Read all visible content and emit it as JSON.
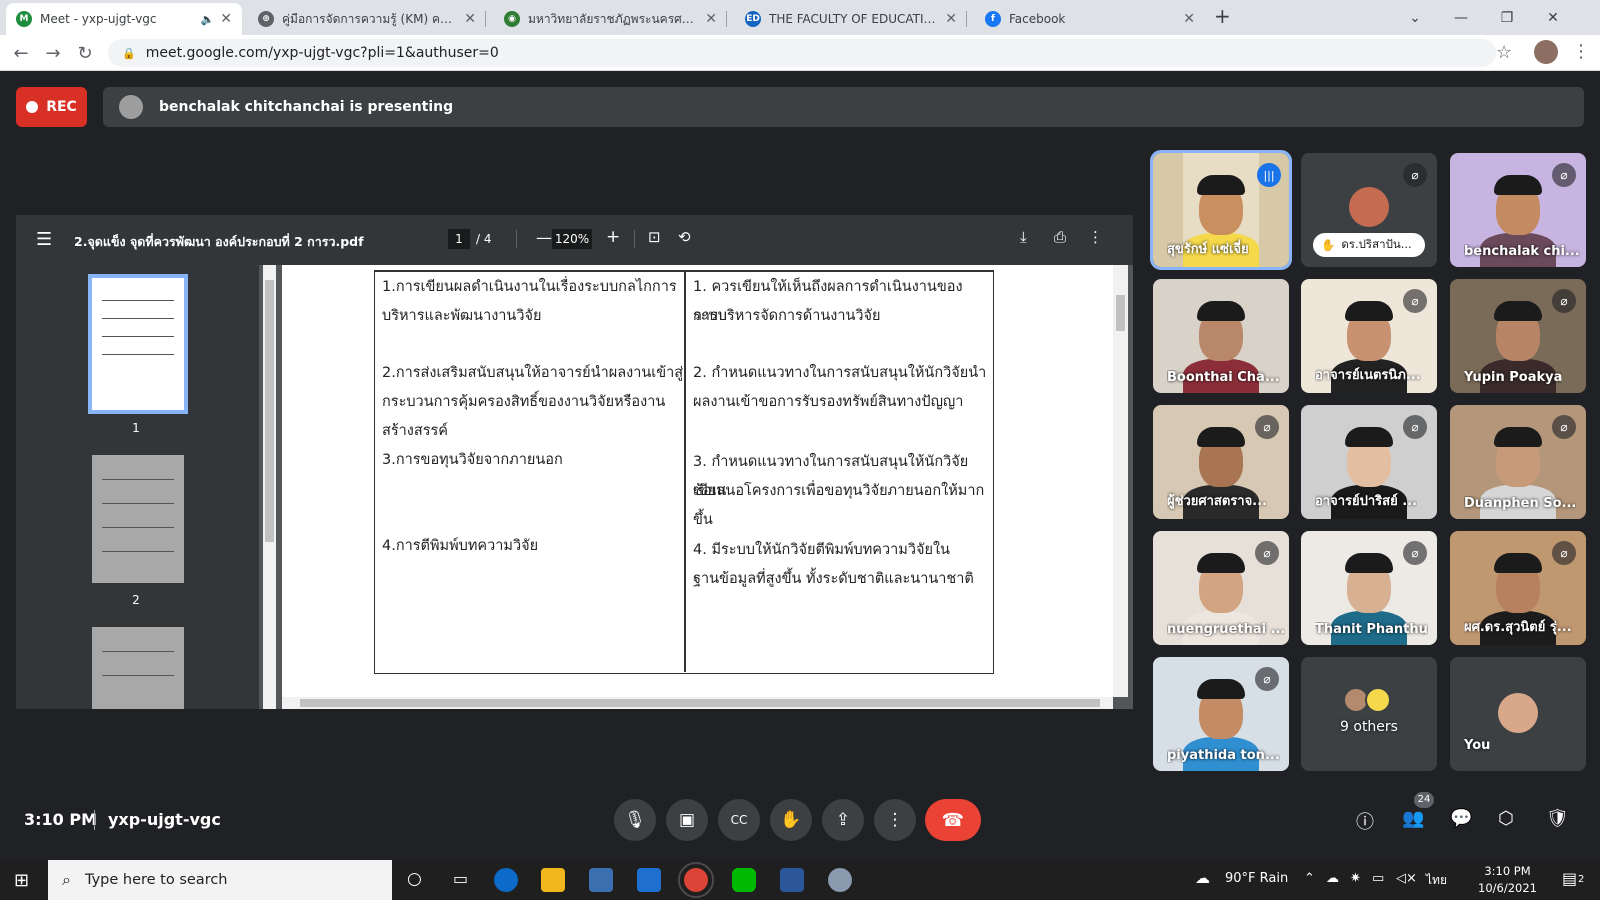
{
  "tabs": [
    {
      "title": "Meet - yxp-ujgt-vgc",
      "color": "#1e8e3e",
      "glyph": "M",
      "has_audio": true,
      "audio_icon": "speaker-icon"
    },
    {
      "title": "คู่มือการจัดการความรู้ (KM) คณะครุศาสตร์",
      "color": "#5f6368",
      "glyph": "⊕",
      "has_audio": false
    },
    {
      "title": "มหาวิทยาลัยราชภัฏพระนครศรีอยุธยา",
      "color": "#2e7d32",
      "glyph": "◉",
      "has_audio": false
    },
    {
      "title": "THE FACULTY OF EDUCATION",
      "color": "#1565c0",
      "glyph": "ED",
      "has_audio": false
    },
    {
      "title": "Facebook",
      "color": "#1877f2",
      "glyph": "f",
      "has_audio": false
    }
  ],
  "close_glyph": "✕",
  "newtab_glyph": "+",
  "window_controls": {
    "dropdown": "⌄",
    "minimize": "—",
    "maximize": "❐",
    "close": "✕"
  },
  "address": {
    "url": "meet.google.com/yxp-ujgt-vgc?pli=1&authuser=0",
    "lock_glyph": "🔒"
  },
  "nav_glyphs": {
    "back": "←",
    "forward": "→",
    "reload": "↻",
    "star": "☆",
    "kebab": "⋮"
  },
  "rec_label": "REC",
  "presenting_text": "benchalak chitchanchai is presenting",
  "pdf": {
    "filename": "2.จุดแข็ง จุดที่ควรพัฒนา องค์ประกอบที่ 2 การว.pdf",
    "current_page": "1",
    "total_pages": "/  4",
    "zoom": "120%",
    "zoom_out": "—",
    "zoom_in": "+",
    "menu_glyph": "☰",
    "fit_glyph": "⊡",
    "rotate_glyph": "⟲",
    "download_glyph": "⤓",
    "print_glyph": "⎙",
    "more_glyph": "⋮",
    "thumb_numbers": [
      "1",
      "2"
    ],
    "left_column": [
      "1.การเขียนผลดำเนินงานในเรื่องระบบกลไกการ",
      "บริหารและพัฒนางานวิจัย",
      "2.การส่งเสริมสนับสนุนให้อาจารย์นำผลงานเข้าสู่",
      "กระบวนการคุ้มครองสิทธิ์ของงานวิจัยหรืองาน",
      "สร้างสรรค์",
      "3.การขอทุนวิจัยจากภายนอก",
      "4.การตีพิมพ์บทความวิจัย"
    ],
    "right_column": [
      "1.  ควรเขียนให้เห็นถึงผลการดำเนินงานของระบบ",
      "การบริหารจัดการด้านงานวิจัย",
      "2.  กำหนดแนวทางในการสนับสนุนให้นักวิจัยนำ",
      "ผลงานเข้าขอการรับรองทรัพย์สินทางปัญญา",
      "3.  กำหนดแนวทางในการสนับสนุนให้นักวิจัยเขียน",
      "ข้อเสนอโครงการเพื่อขอทุนวิจัยภายนอกให้มากขึ้น",
      "4.  มีระบบให้นักวิจัยตีพิมพ์บทความวิจัยใน",
      "ฐานข้อมูลที่สูงขึ้น ทั้งระดับชาติและนานาชาติ"
    ]
  },
  "participants": [
    {
      "name": "สุขรักษ์ แซ่เจี่ย",
      "bg": "#d7c9a8",
      "skin": "#c98f5e",
      "shirt": "#f5d94a",
      "muted": false,
      "speaking": true
    },
    {
      "name": "ดร.ปริสาปัน...",
      "bg": "#3c4043",
      "avatar": true,
      "avatar_color": "#c56b52",
      "muted": true,
      "pill": true,
      "hand_icon": "✋"
    },
    {
      "name": "benchalak chi...",
      "bg": "#c8b4e0",
      "skin": "#c48a62",
      "shirt": "#6a4a5a",
      "muted": true
    },
    {
      "name": "Boonthai Cha...",
      "bg": "#d8d2c8",
      "skin": "#b9876a",
      "shirt": "#8b2e3a",
      "muted": false
    },
    {
      "name": "อาจารย์เนตรนิภ...",
      "bg": "#efe6da",
      "skin": "#c89270",
      "shirt": "#222222",
      "muted": true
    },
    {
      "name": "Yupin Poakya",
      "bg": "#7a6a58",
      "skin": "#b88466",
      "shirt": "#3a2a2a",
      "muted": true
    },
    {
      "name": "ผู้ช่วยศาสตราจ...",
      "bg": "#d6c8b2",
      "skin": "#a87452",
      "shirt": "#2a2a2a",
      "muted": true
    },
    {
      "name": "อาจารย์ปาริสย์ ...",
      "bg": "#cfcfcf",
      "skin": "#e4bea0",
      "shirt": "#1a1a1a",
      "muted": true
    },
    {
      "name": "Duanphen So...",
      "bg": "#b4977a",
      "skin": "#c79a7a",
      "shirt": "#d6d6d6",
      "muted": true
    },
    {
      "name": "nuengruethai ...",
      "bg": "#e6e0d8",
      "skin": "#d2a482",
      "shirt": "#ece6de",
      "muted": true
    },
    {
      "name": "Thanit Phanthu",
      "bg": "#ede9e4",
      "skin": "#d8b092",
      "shirt": "#1e6b8a",
      "muted": true
    },
    {
      "name": "ผศ.ดร.สุวนิตย์ รุ่...",
      "bg": "#c09870",
      "skin": "#b7805e",
      "shirt": "#1c1c1c",
      "muted": true
    },
    {
      "name": "piyathida ton...",
      "bg": "#d7dfe6",
      "skin": "#c48c64",
      "shirt": "#2f8fd0",
      "muted": true
    },
    {
      "name": "9 others",
      "bg": "#3c4043",
      "others": true,
      "muted": false
    },
    {
      "name": "You",
      "bg": "#3c4043",
      "avatar": true,
      "avatar_color": "#d9a88a",
      "muted": false,
      "you": true
    }
  ],
  "mute_glyph": "⌀",
  "talk_glyph": "|||",
  "bottom": {
    "time": "3:10 PM",
    "meeting_code": "yxp-ujgt-vgc",
    "controls": [
      {
        "name": "mic-button",
        "glyph": "🎙",
        "icon": "mic-icon"
      },
      {
        "name": "camera-button",
        "glyph": "▣",
        "icon": "camera-icon"
      },
      {
        "name": "captions-button",
        "glyph": "CC",
        "icon": "captions-icon"
      },
      {
        "name": "raise-hand-button",
        "glyph": "✋",
        "icon": "hand-icon"
      },
      {
        "name": "present-button",
        "glyph": "⇪",
        "icon": "present-icon"
      },
      {
        "name": "more-options-button",
        "glyph": "⋮",
        "icon": "more-vert-icon"
      }
    ],
    "end_call_glyph": "☎",
    "right_icons": [
      {
        "name": "meeting-details-button",
        "glyph": "ⓘ",
        "icon": "info-icon"
      },
      {
        "name": "people-button",
        "glyph": "👥",
        "icon": "people-icon"
      },
      {
        "name": "chat-button",
        "glyph": "💬",
        "icon": "chat-icon"
      },
      {
        "name": "activities-button",
        "glyph": "⬡",
        "icon": "activities-icon"
      },
      {
        "name": "host-controls-button",
        "glyph": "🛡",
        "icon": "shield-icon"
      }
    ],
    "people_count": "24"
  },
  "taskbar": {
    "search_placeholder": "Type here to search",
    "windows_glyph": "⊞",
    "search_glyph": "⌕",
    "weather": "90°F  Rain",
    "lang": "ไทย",
    "clock_time": "3:10 PM",
    "clock_date": "10/6/2021",
    "notif_count": "2"
  }
}
